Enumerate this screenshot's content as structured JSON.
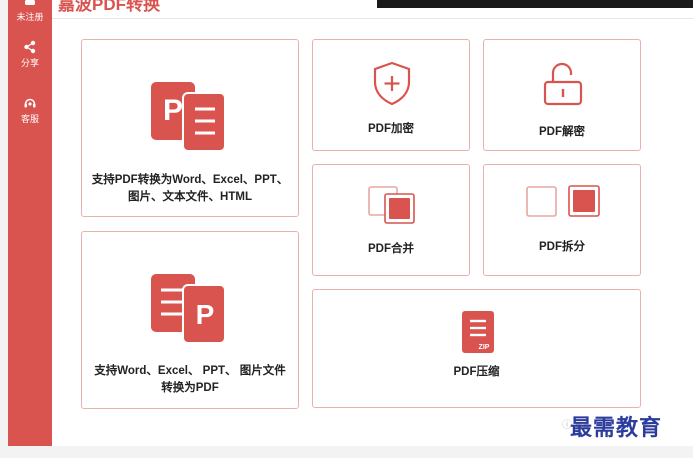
{
  "app": {
    "title": "嘉波PDF转换",
    "accent": "#d9534f",
    "card_border": "#e8b1ad"
  },
  "sidebar": {
    "items": [
      {
        "label": "未注册",
        "icon": "user-icon"
      },
      {
        "label": "分享",
        "icon": "share-icon"
      },
      {
        "label": "客服",
        "icon": "headset-icon"
      }
    ]
  },
  "cards": {
    "pdf_to_other": {
      "line1": "支持PDF转换为Word、Excel、PPT、",
      "line2": "图片、文本文件、HTML",
      "icon": "pdf-to-doc-icon"
    },
    "other_to_pdf": {
      "line1": "支持Word、Excel、 PPT、 图片文件",
      "line2": "转换为PDF",
      "icon": "doc-to-pdf-icon"
    },
    "encrypt": {
      "label": "PDF加密",
      "icon": "shield-plus-icon"
    },
    "decrypt": {
      "label": "PDF解密",
      "icon": "unlock-icon"
    },
    "merge": {
      "label": "PDF合并",
      "icon": "merge-icon"
    },
    "split": {
      "label": "PDF拆分",
      "icon": "split-icon"
    },
    "compress": {
      "label": "PDF压缩",
      "icon": "zip-file-icon",
      "badge": "ZIP"
    }
  },
  "watermark": {
    "text": "最需教育",
    "prefix": "ⓘ ◆◆"
  }
}
